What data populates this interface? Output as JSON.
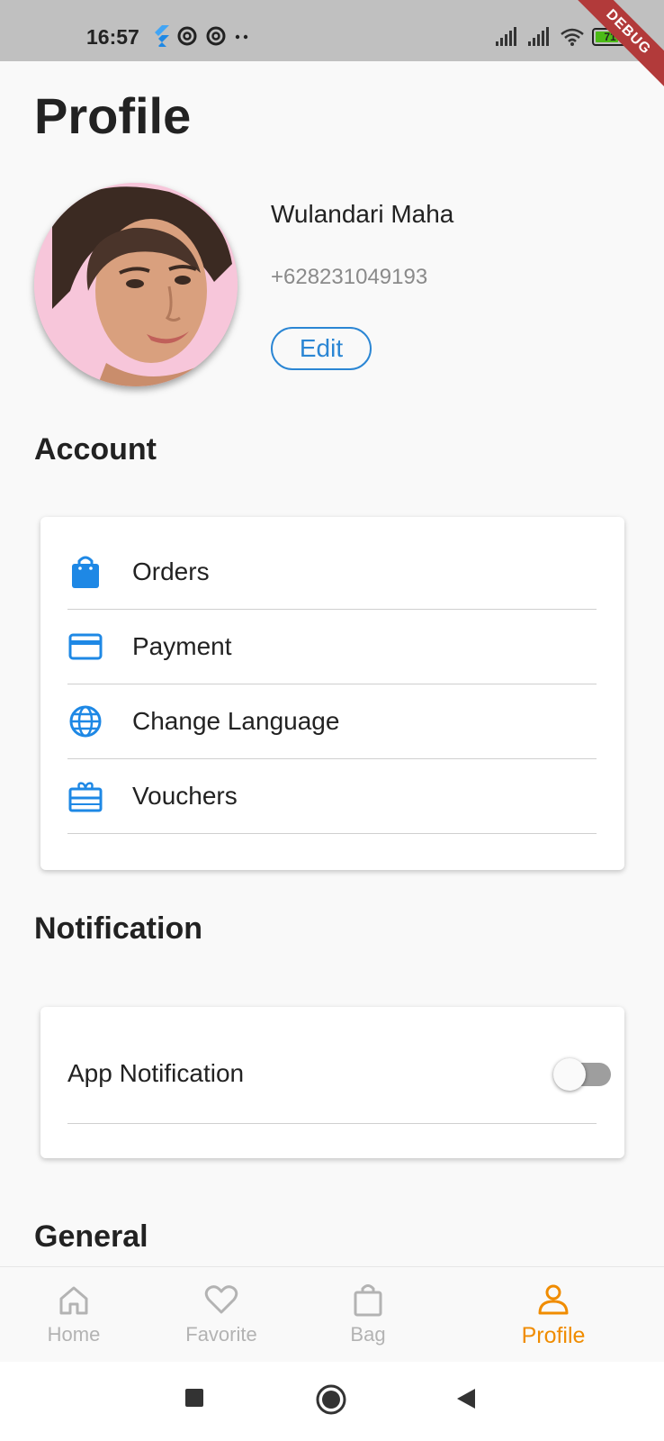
{
  "status_bar": {
    "time": "16:57",
    "battery": "71",
    "debug_label": "DEBUG"
  },
  "page": {
    "title": "Profile"
  },
  "profile": {
    "name": "Wulandari Maha",
    "phone": "+628231049193",
    "edit_label": "Edit"
  },
  "account": {
    "title": "Account",
    "items": [
      {
        "label": "Orders",
        "icon": "shopping-bag-icon"
      },
      {
        "label": "Payment",
        "icon": "credit-card-icon"
      },
      {
        "label": "Change Language",
        "icon": "globe-icon"
      },
      {
        "label": "Vouchers",
        "icon": "voucher-icon"
      }
    ]
  },
  "notification": {
    "title": "Notification",
    "app_notification_label": "App Notification",
    "app_notification_enabled": false
  },
  "general": {
    "title": "General"
  },
  "bottom_nav": {
    "items": [
      {
        "label": "Home",
        "icon": "home-icon"
      },
      {
        "label": "Favorite",
        "icon": "heart-icon"
      },
      {
        "label": "Bag",
        "icon": "bag-icon"
      },
      {
        "label": "Profile",
        "icon": "person-icon"
      }
    ],
    "active_index": 3
  },
  "colors": {
    "accent_blue": "#2b86d4",
    "active_orange": "#f08c00",
    "inactive_gray": "#b3b3b3"
  }
}
